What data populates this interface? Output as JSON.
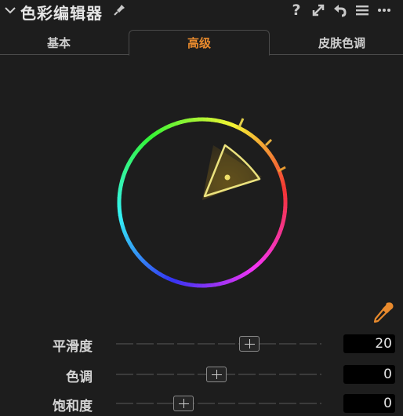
{
  "panel": {
    "title": "色彩编辑器"
  },
  "header_icons": [
    "collapse-chevron-icon",
    "pin-icon",
    "help-icon",
    "expand-icon",
    "reset-icon",
    "menu-icon",
    "more-icon"
  ],
  "tabs": [
    {
      "label": "基本",
      "active": false
    },
    {
      "label": "高级",
      "active": true
    },
    {
      "label": "皮肤色调",
      "active": false
    }
  ],
  "accent_color": "#e88a2d",
  "sliders": [
    {
      "label": "平滑度",
      "value": "20",
      "level": 0.65
    },
    {
      "label": "色调",
      "value": "0",
      "level": 0.49
    },
    {
      "label": "饱和度",
      "value": "0",
      "level": 0.33
    }
  ]
}
